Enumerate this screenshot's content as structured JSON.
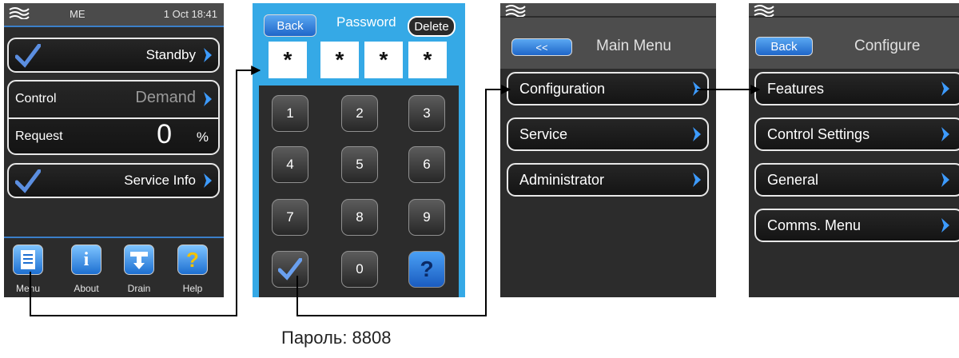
{
  "screen1": {
    "header_user": "ME",
    "header_time": "1 Oct 18:41",
    "standby_label": "Standby",
    "control_label": "Control",
    "control_value": "Demand",
    "request_label": "Request",
    "request_value": "0",
    "request_unit": "%",
    "service_info_label": "Service Info",
    "dock": [
      "Menu",
      "About",
      "Drain",
      "Help"
    ]
  },
  "screen2": {
    "back_label": "Back",
    "title": "Password",
    "delete_label": "Delete",
    "password_chars": [
      "*",
      "*",
      "*",
      "*"
    ],
    "keys": [
      "1",
      "2",
      "3",
      "4",
      "5",
      "6",
      "7",
      "8",
      "9",
      "0",
      "?"
    ]
  },
  "screen3": {
    "back_label": "<<",
    "title": "Main Menu",
    "items": [
      "Configuration",
      "Service",
      "Administrator"
    ]
  },
  "screen4": {
    "back_label": "Back",
    "title": "Configure",
    "items": [
      "Features",
      "Control Settings",
      "General",
      "Comms. Menu"
    ]
  },
  "caption": "Пароль: 8808",
  "colors": {
    "accent": "#3b7fc9",
    "frame": "#35a9e6",
    "dark_bg": "#2c2c2c"
  }
}
